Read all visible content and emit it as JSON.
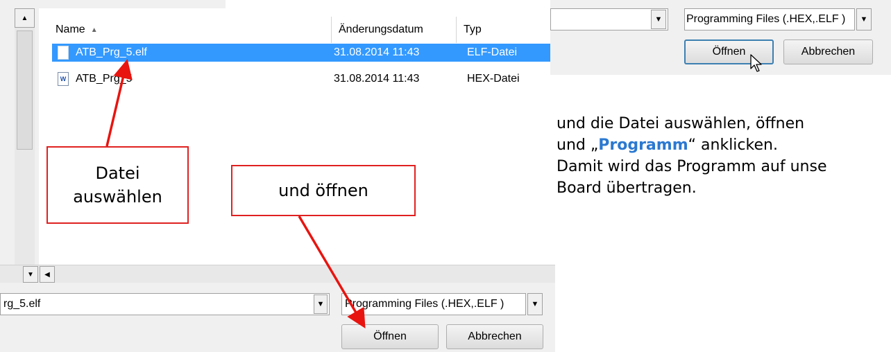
{
  "file_list": {
    "columns": {
      "name": "Name",
      "date": "Änderungsdatum",
      "type": "Typ"
    },
    "files": [
      {
        "name": "ATB_Prg_5.elf",
        "date": "31.08.2014 11:43",
        "type": "ELF-Datei",
        "selected": true
      },
      {
        "name": "ATB_Prg_5",
        "date": "31.08.2014 11:43",
        "type": "HEX-Datei",
        "selected": false
      }
    ]
  },
  "dialog_bottom": {
    "filename_value": "rg_5.elf",
    "filter_value": "Programming Files (.HEX,.ELF )",
    "open_label": "Öffnen",
    "cancel_label": "Abbrechen"
  },
  "dialog_top_right": {
    "filter_value": "Programming Files (.HEX,.ELF )",
    "open_label": "Öffnen",
    "cancel_label": "Abbrechen"
  },
  "callouts": {
    "select_file_line1": "Datei",
    "select_file_line2": "auswählen",
    "and_open": "und öffnen"
  },
  "instructions": {
    "line1": "und die Datei auswählen, öffnen",
    "line2_pre": "und „",
    "line2_keyword": "Programm",
    "line2_post": "“ anklicken.",
    "line3": "Damit wird das Programm auf unse",
    "line4": "Board übertragen."
  },
  "colors": {
    "selection": "#3399ff",
    "callout_border": "#e02020",
    "arrow": "#e8140f",
    "keyword": "#2b79d0"
  }
}
